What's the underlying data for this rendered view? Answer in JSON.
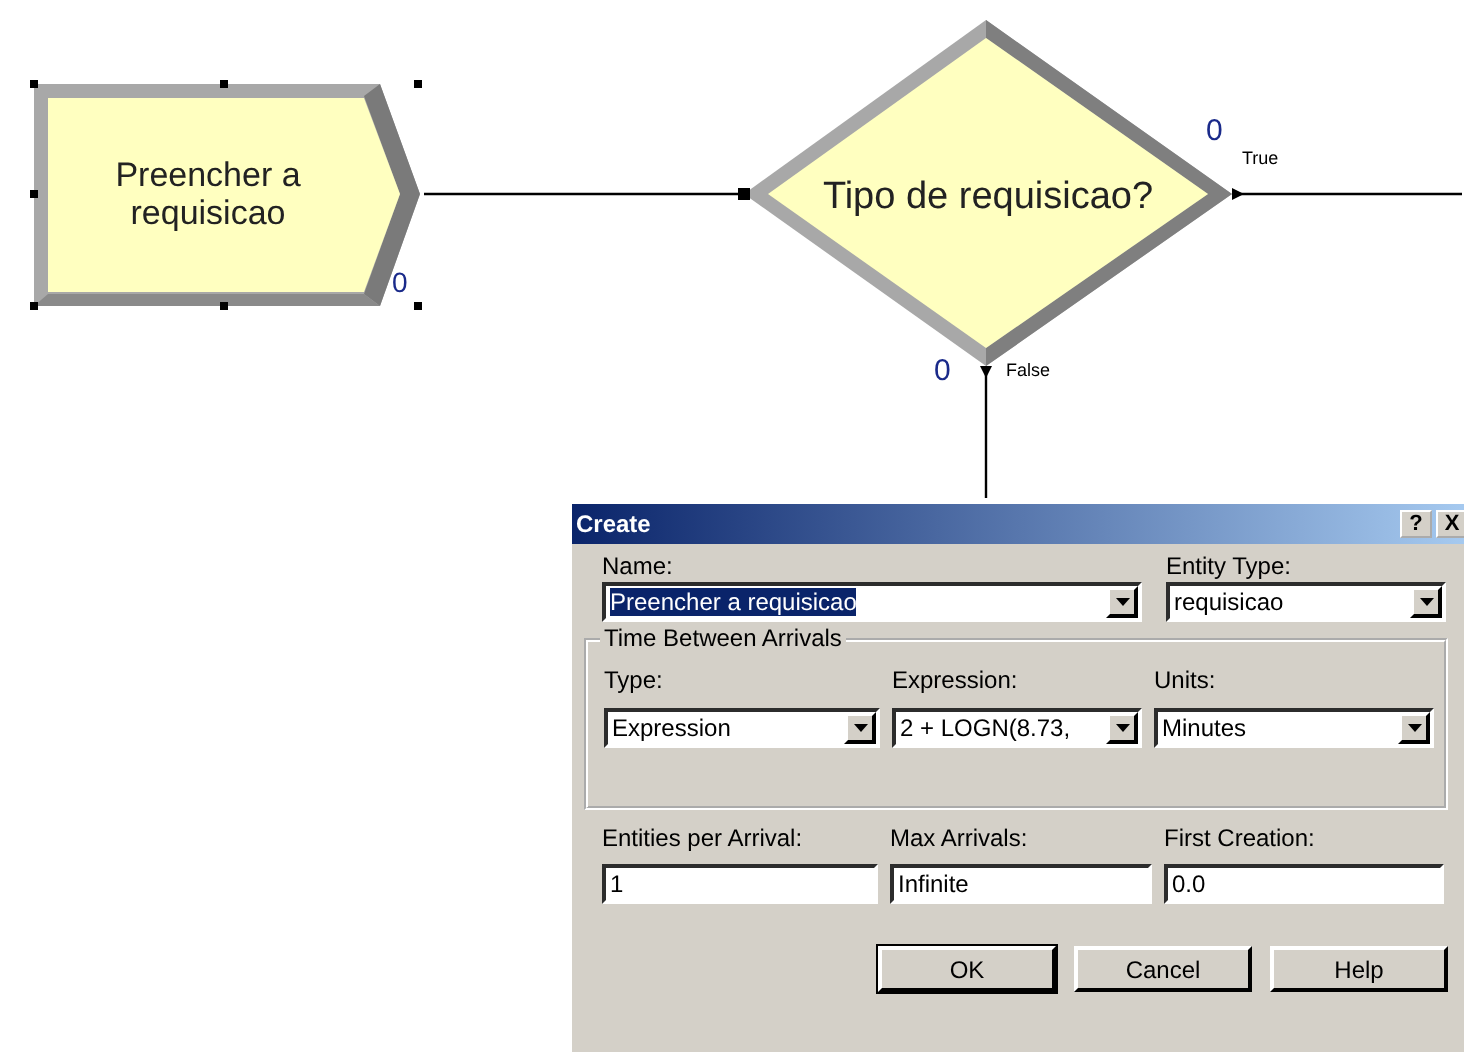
{
  "modules": [
    {
      "kind": "create",
      "label_lines": [
        "Preencher a",
        "requisicao"
      ],
      "counter": "0",
      "selected": true
    },
    {
      "kind": "decide",
      "label": "Tipo de requisicao?",
      "outputs": [
        {
          "label": "True",
          "counter": "0"
        },
        {
          "label": "False",
          "counter": "0"
        }
      ],
      "selected": false
    }
  ],
  "dialog": {
    "title": "Create",
    "help_button": "?",
    "close_button": "X",
    "name": {
      "label": "Name:",
      "value": "Preencher a requisicao",
      "highlighted": true
    },
    "entity_type": {
      "label": "Entity Type:",
      "value": "requisicao"
    },
    "group": {
      "title": "Time Between Arrivals",
      "fields": [
        {
          "label": "Type:",
          "value": "Expression"
        },
        {
          "label": "Expression:",
          "value": "2 + LOGN(8.73,"
        },
        {
          "label": "Units:",
          "value": "Minutes"
        }
      ]
    },
    "fields": [
      {
        "label": "Entities per Arrival:",
        "value": "1"
      },
      {
        "label": "Max Arrivals:",
        "value": "Infinite"
      },
      {
        "label": "First Creation:",
        "value": "0.0"
      }
    ],
    "buttons": [
      {
        "label": "OK",
        "default": true
      },
      {
        "label": "Cancel",
        "default": false
      },
      {
        "label": "Help",
        "default": false
      }
    ]
  }
}
